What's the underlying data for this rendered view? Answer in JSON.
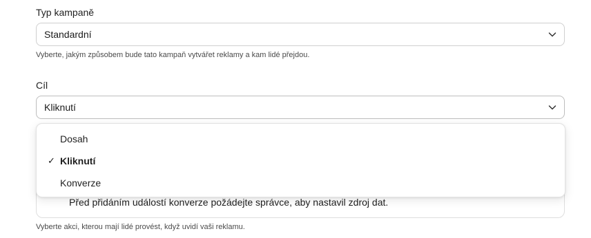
{
  "campaign_type": {
    "label": "Typ kampaně",
    "value": "Standardní",
    "help": "Vyberte, jakým způsobem bude tato kampaň vytvářet reklamy a kam lidé přejdou."
  },
  "goal": {
    "label": "Cíl",
    "value": "Kliknutí",
    "options": [
      {
        "label": "Dosah",
        "selected": false
      },
      {
        "label": "Kliknutí",
        "selected": true,
        "check": "✓"
      },
      {
        "label": "Konverze",
        "selected": false
      }
    ],
    "notice": "Před přidáním událostí konverze požádejte správce, aby nastavil zdroj dat.",
    "help": "Vyberte akci, kterou mají lidé provést, když uvidí vaši reklamu."
  },
  "icons": {
    "select_chevron": "chevron-down-icon",
    "notice_icon": "info-icon"
  }
}
